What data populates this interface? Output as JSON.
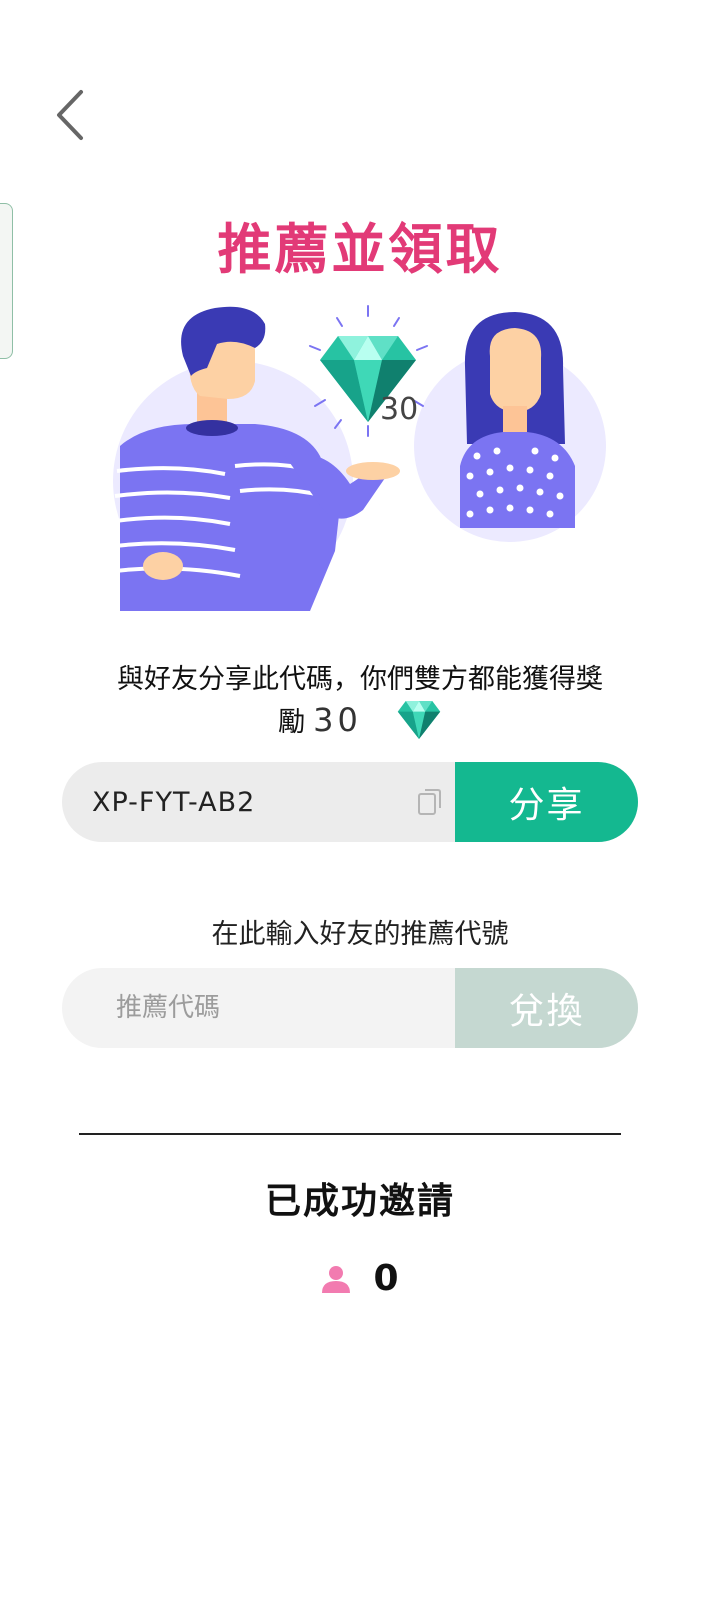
{
  "header": {
    "title": "推薦並領取"
  },
  "hero": {
    "reward_badge": "30"
  },
  "share_section": {
    "description_line1": "與好友分享此代碼，你們雙方都能獲得獎",
    "description_line2_prefix": "勵",
    "reward_amount": "30",
    "referral_code": "XP-FYT-AB2",
    "share_label": "分享"
  },
  "redeem_section": {
    "label": "在此輸入好友的推薦代號",
    "placeholder": "推薦代碼",
    "redeem_label": "兌換"
  },
  "invited_section": {
    "title": "已成功邀請",
    "count": "0"
  },
  "colors": {
    "title_pink": "#e23a77",
    "share_green": "#14b890",
    "redeem_disabled": "#c5d8d1",
    "illustration_purple": "#7b6ff5",
    "user_icon_pink": "#f27bb0"
  },
  "icons": {
    "back": "chevron-left-icon",
    "copy": "copy-icon",
    "gem": "diamond-gem-icon",
    "user": "person-icon"
  }
}
